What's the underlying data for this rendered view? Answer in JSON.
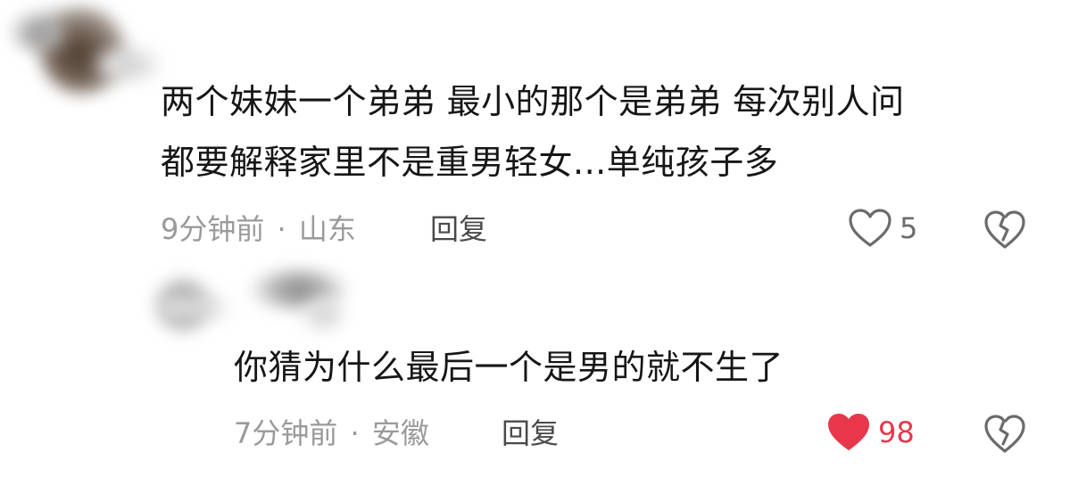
{
  "comments": [
    {
      "author_avatar": "blurred-avatar",
      "lines": [
        "两个妹妹一个弟弟 最小的那个是弟弟 每次别人问",
        "都要解释家里不是重男轻女...单纯孩子多"
      ],
      "time": "9分钟前",
      "location": "山东",
      "meta_separator": "·",
      "reply_label": "回复",
      "like_count": "5",
      "liked": false,
      "like_icon": "heart-outline-icon",
      "dislike_icon": "broken-heart-icon"
    },
    {
      "author_avatar": "blurred-avatar",
      "lines": [
        "你猜为什么最后一个是男的就不生了"
      ],
      "time": "7分钟前",
      "location": "安徽",
      "meta_separator": "·",
      "reply_label": "回复",
      "like_count": "98",
      "liked": true,
      "like_icon": "heart-filled-icon",
      "dislike_icon": "broken-heart-icon"
    }
  ],
  "colors": {
    "text": "#161616",
    "meta": "#9a9a9a",
    "like_active": "#e8374b"
  }
}
